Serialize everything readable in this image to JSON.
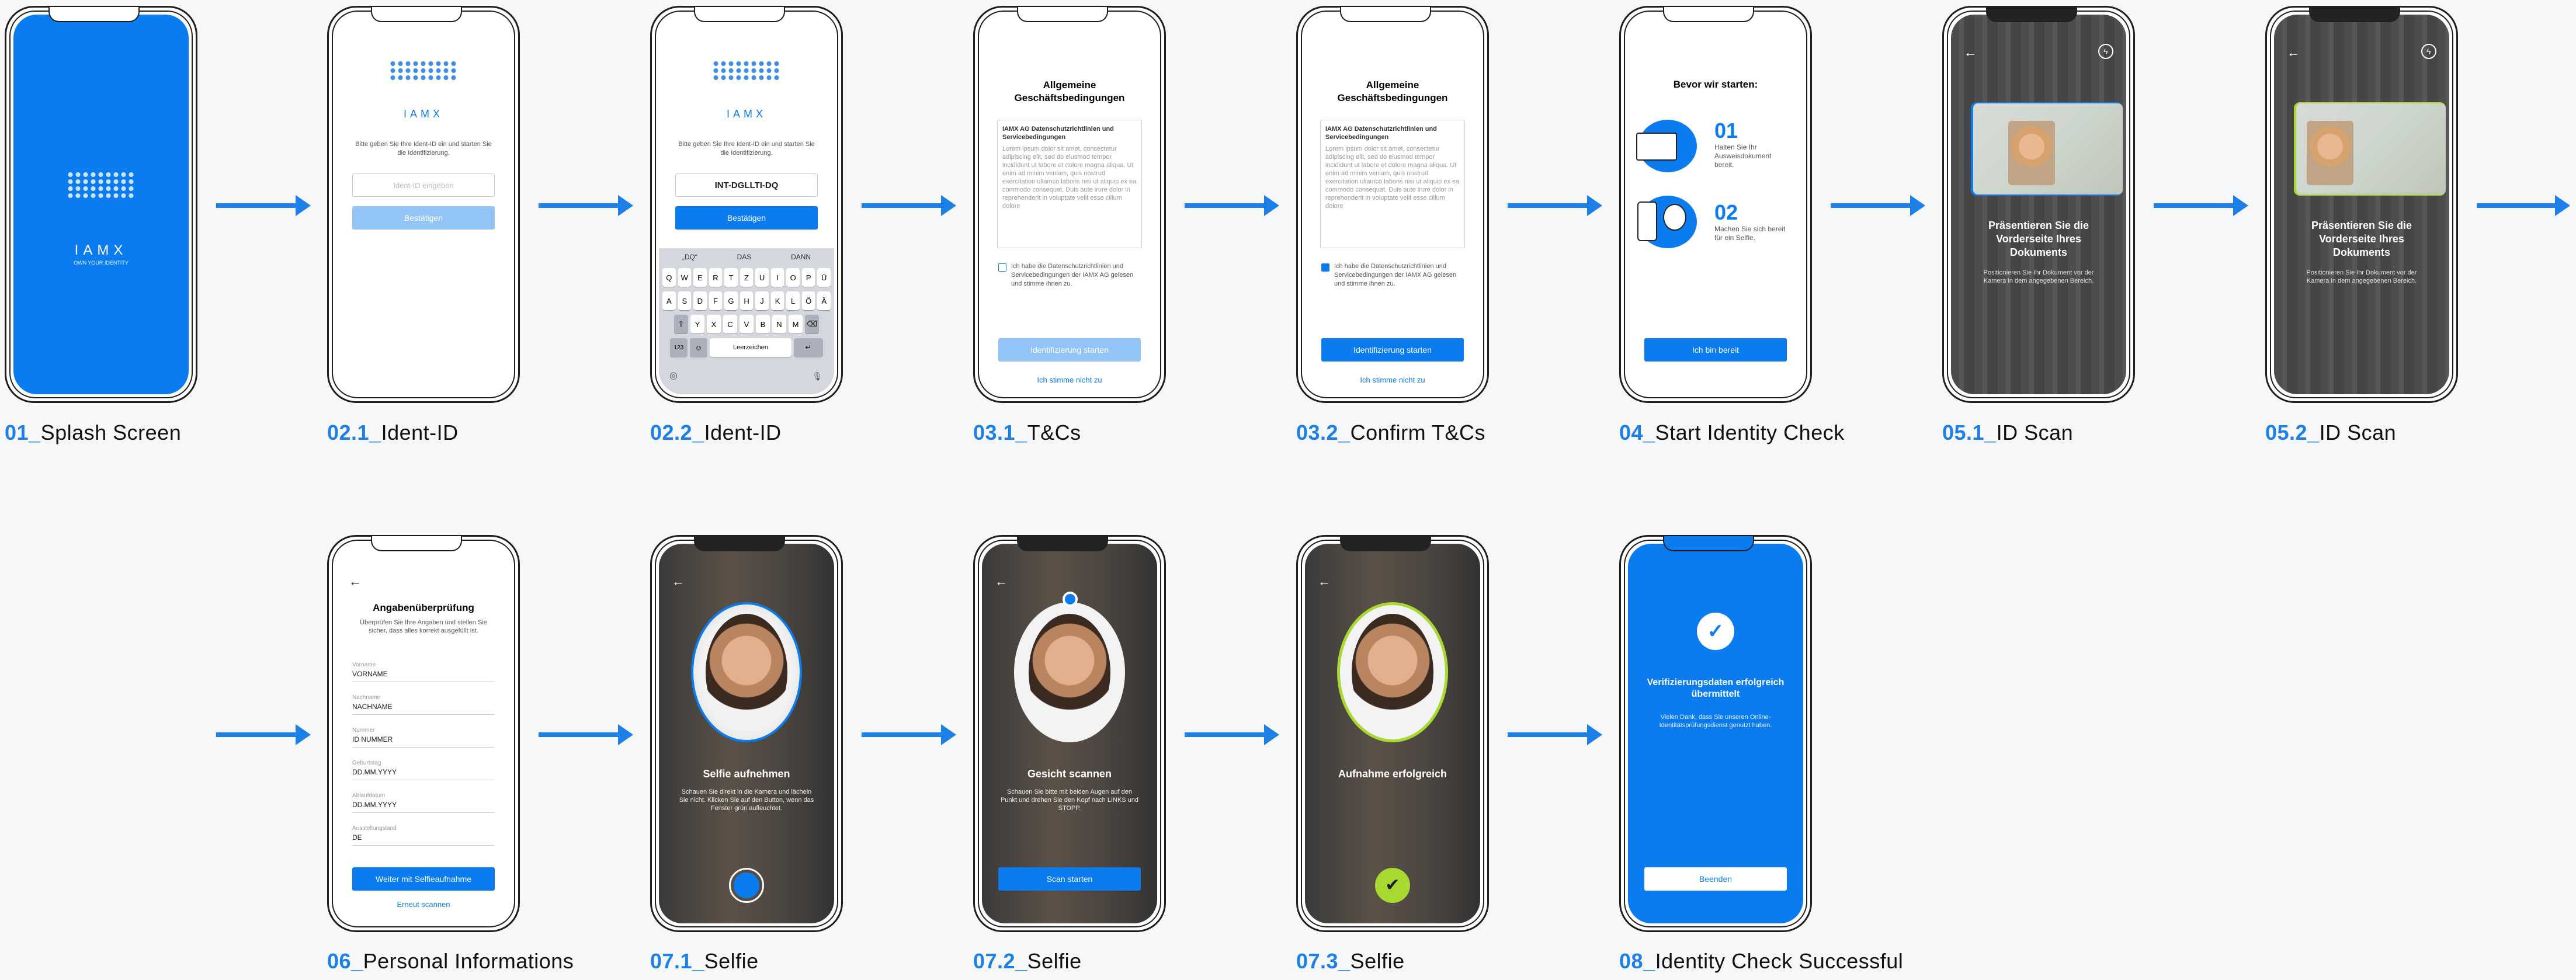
{
  "captions": {
    "c1": {
      "num": "01_",
      "label": "Splash Screen"
    },
    "c2": {
      "num": "02.1_",
      "label": "Ident-ID"
    },
    "c3": {
      "num": "02.2_",
      "label": "Ident-ID"
    },
    "c4": {
      "num": "03.1_",
      "label": "T&Cs"
    },
    "c5": {
      "num": "03.2_",
      "label": "Confirm T&Cs"
    },
    "c6": {
      "num": "04_",
      "label": "Start Identity Check"
    },
    "c7": {
      "num": "05.1_",
      "label": "ID Scan"
    },
    "c8": {
      "num": "05.2_",
      "label": "ID Scan"
    },
    "c9": {
      "num": "06_",
      "label": "Personal Informations"
    },
    "c10": {
      "num": "07.1_",
      "label": "Selfie"
    },
    "c11": {
      "num": "07.2_",
      "label": "Selfie"
    },
    "c12": {
      "num": "07.3_",
      "label": "Selfie"
    },
    "c13": {
      "num": "08_",
      "label": "Identity Check Successful"
    }
  },
  "brand": {
    "name": "IAMX",
    "tagline": "OWN YOUR IDENTITY",
    "accent": "#0a7cf0",
    "arrow": "#1d7fe8",
    "success": "#a8d930"
  },
  "ident": {
    "intro": "Bitte geben Sie Ihre Ident-ID ein und starten Sie die Identifizierung.",
    "placeholder": "Ident-ID eingeben",
    "value": "INT-DGLLTI-DQ",
    "confirm": "Bestätigen"
  },
  "keyboard": {
    "suggestions": [
      "„DQ“",
      "DAS",
      "DANN"
    ],
    "row1": [
      "Q",
      "W",
      "E",
      "R",
      "T",
      "Z",
      "U",
      "I",
      "O",
      "P",
      "Ü"
    ],
    "row2": [
      "A",
      "S",
      "D",
      "F",
      "G",
      "H",
      "J",
      "K",
      "L",
      "Ö",
      "Ä"
    ],
    "row3": [
      "Y",
      "X",
      "C",
      "V",
      "B",
      "N",
      "M"
    ],
    "numkey": "123",
    "space": "Leerzeichen"
  },
  "tcs": {
    "title": "Allgemeine Geschäftsbedingungen",
    "box_title": "IAMX AG Datenschutzrichtlinien und Servicebedingungen",
    "box_text": "Lorem ipsum dolor sit amet, consectetur adipiscing elit, sed do eiusmod tempor incididunt ut labore et dolore magna aliqua. Ut enim ad minim veniam, quis nostrud exercitation ullamco laboris nisi ut aliquip ex ea commodo consequat. Duis aute irure dolor in reprehenderit in voluptate velit esse cillum dolore",
    "checkbox": "Ich habe die Datenschutzrichtlinien und Servicebedingungen der IAMX AG gelesen und stimme ihnen zu.",
    "start": "Identifizierung starten",
    "decline": "Ich stimme nicht zu"
  },
  "start": {
    "title": "Bevor wir starten:",
    "step1_num": "01",
    "step1_text": "Halten Sie Ihr Ausweisdokument bereit.",
    "step2_num": "02",
    "step2_text": "Machen Sie sich bereit für ein Selfie.",
    "button": "Ich bin bereit"
  },
  "scan": {
    "title": "Präsentieren Sie die Vorderseite Ihres Dokuments",
    "text": "Positionieren Sie Ihr Dokument vor der Kamera in dem angegebenen Bereich."
  },
  "personal": {
    "title": "Angabenüberprüfung",
    "intro": "Überprüfen Sie Ihre Angaben und stellen Sie sicher, dass alles korrekt ausgefüllt ist.",
    "fields": [
      {
        "label": "Vorname",
        "value": "VORNAME"
      },
      {
        "label": "Nachname",
        "value": "NACHNAME"
      },
      {
        "label": "Nummer",
        "value": "ID NUMMER"
      },
      {
        "label": "Geburtstag",
        "value": "DD.MM.YYYY"
      },
      {
        "label": "Ablaufdatum",
        "value": "DD.MM.YYYY"
      },
      {
        "label": "Ausstellungsland",
        "value": "DE"
      }
    ],
    "continue": "Weiter mit Selfieaufnahme",
    "rescan": "Erneut scannen"
  },
  "selfie1": {
    "title": "Selfie aufnehmen",
    "text": "Schauen Sie direkt in die Kamera und lächeln Sie nicht. Klicken Sie auf den Button, wenn das Fenster grün aufleuchtet."
  },
  "selfie2": {
    "title": "Gesicht scannen",
    "text": "Schauen Sie bitte mit beiden Augen auf den Punkt und drehen Sie den Kopf nach LINKS und STOPP.",
    "button": "Scan starten"
  },
  "selfie3": {
    "title": "Aufnahme erfolgreich"
  },
  "success": {
    "title": "Verifizierungsdaten erfolgreich übermittelt",
    "text": "Vielen Dank, dass Sie unseren Online-Identitätsprüfungsdienst genutzt haben.",
    "button": "Beenden"
  },
  "icons": {
    "arrow": "right-arrow-icon",
    "back": "back-arrow-icon",
    "check": "checkmark-icon",
    "flash": "flash-icon"
  }
}
